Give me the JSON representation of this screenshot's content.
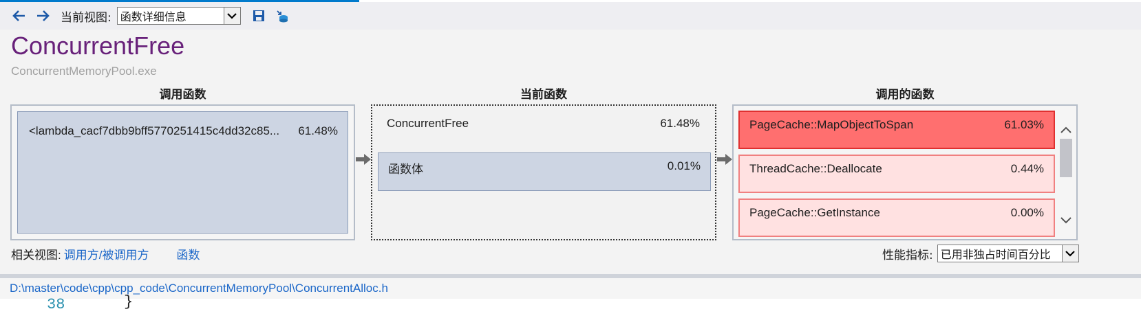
{
  "toolbar": {
    "current_view_label": "当前视图:",
    "current_view_value": "函数详细信息",
    "icons": [
      "back-arrow-icon",
      "forward-arrow-icon",
      "save-icon",
      "export-icon"
    ]
  },
  "function": {
    "name": "ConcurrentFree",
    "module": "ConcurrentMemoryPool.exe"
  },
  "columns": {
    "callers_title": "调用函数",
    "current_title": "当前函数",
    "callees_title": "调用的函数"
  },
  "callers": [
    {
      "name": "<lambda_cacf7dbb9bff5770251415c4dd32c85...",
      "percent": "61.48%"
    }
  ],
  "current": {
    "name": "ConcurrentFree",
    "percent": "61.48%",
    "body_label": "函数体",
    "body_percent": "0.01%"
  },
  "callees": [
    {
      "name": "PageCache::MapObjectToSpan",
      "percent": "61.03%"
    },
    {
      "name": "ThreadCache::Deallocate",
      "percent": "0.44%"
    },
    {
      "name": "PageCache::GetInstance",
      "percent": "0.00%"
    }
  ],
  "related": {
    "label": "相关视图:",
    "link1": "调用方/被调用方",
    "link2": "函数"
  },
  "metric": {
    "label": "性能指标:",
    "value": "已用非独占时间百分比"
  },
  "source": {
    "path": "D:\\master\\code\\cpp\\cpp_code\\ConcurrentMemoryPool\\ConcurrentAlloc.h",
    "line_number": "38",
    "line_text": "}"
  },
  "colors": {
    "accent": "#007acc",
    "title": "#68217a",
    "hot": "#ff6f6f",
    "warm": "#ffe1e1",
    "caller_bg": "#cdd5e3",
    "link": "#1a66c8"
  }
}
